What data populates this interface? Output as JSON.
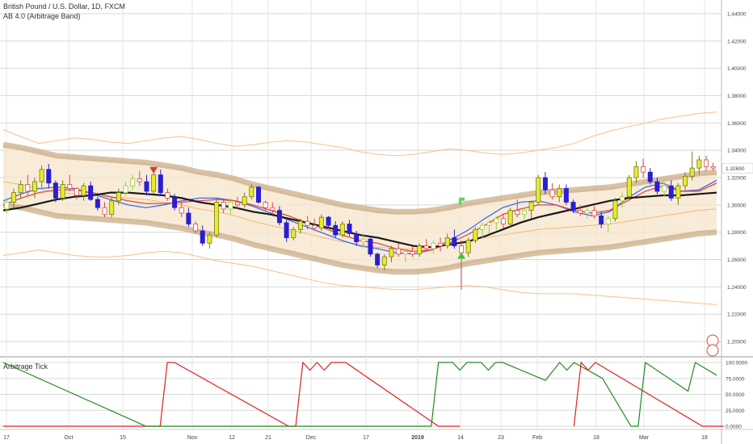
{
  "header": {
    "symbol_title": "British Pound / U.S. Dollar, 1D, FXCM",
    "indicator_name": "AB 4.0 (Arbitrage Band)",
    "sub_pane_title": "Arbitrage Tick"
  },
  "colors": {
    "bull": "#e6ec2a",
    "bear": "#2a1fd0",
    "up_fade": "#9ccc3a",
    "down_fade": "#d64a4a",
    "band": "#c8a880",
    "band_fill": "#f6e6cc",
    "ma_slow": "#1a1a1a",
    "ma_red": "#e8433a",
    "ma_blue": "#3a6cf0",
    "outer_band": "#f5c18a",
    "tick_red": "#e02020",
    "tick_green": "#1f8a1f",
    "current_price_bg": "#e8433a"
  },
  "chart_data": [
    {
      "type": "candlestick",
      "title": "British Pound / U.S. Dollar, 1D, FXCM",
      "subtitle": "AB 4.0 (Arbitrage Band)",
      "y_ticks": [
        "1.44000",
        "1.42000",
        "1.40000",
        "1.38000",
        "1.36000",
        "1.34000",
        "1.32000",
        "1.30000",
        "1.28000",
        "1.26000",
        "1.24000",
        "1.22000",
        "1.20000"
      ],
      "ylim": [
        1.19,
        1.45
      ],
      "x_ticks": [
        "17",
        "Oct",
        "15",
        "Nov",
        "12",
        "21",
        "Dec",
        "17",
        "2019",
        "14",
        "23",
        "Feb",
        "18",
        "Mar",
        "18"
      ],
      "current_price": "1.32690",
      "grid": true,
      "candles": [
        {
          "o": 1.297,
          "h": 1.305,
          "l": 1.294,
          "c": 1.302
        },
        {
          "o": 1.302,
          "h": 1.312,
          "l": 1.298,
          "c": 1.309
        },
        {
          "o": 1.309,
          "h": 1.318,
          "l": 1.305,
          "c": 1.315
        },
        {
          "o": 1.315,
          "h": 1.322,
          "l": 1.307,
          "c": 1.31
        },
        {
          "o": 1.31,
          "h": 1.32,
          "l": 1.305,
          "c": 1.317
        },
        {
          "o": 1.317,
          "h": 1.329,
          "l": 1.313,
          "c": 1.326
        },
        {
          "o": 1.326,
          "h": 1.33,
          "l": 1.312,
          "c": 1.316
        },
        {
          "o": 1.316,
          "h": 1.318,
          "l": 1.302,
          "c": 1.305
        },
        {
          "o": 1.305,
          "h": 1.318,
          "l": 1.303,
          "c": 1.315
        },
        {
          "o": 1.315,
          "h": 1.322,
          "l": 1.31,
          "c": 1.312
        },
        {
          "o": 1.312,
          "h": 1.313,
          "l": 1.304,
          "c": 1.307
        },
        {
          "o": 1.307,
          "h": 1.316,
          "l": 1.303,
          "c": 1.314
        },
        {
          "o": 1.314,
          "h": 1.317,
          "l": 1.303,
          "c": 1.304
        },
        {
          "o": 1.304,
          "h": 1.306,
          "l": 1.296,
          "c": 1.298
        },
        {
          "o": 1.298,
          "h": 1.302,
          "l": 1.291,
          "c": 1.293
        },
        {
          "o": 1.293,
          "h": 1.306,
          "l": 1.291,
          "c": 1.303
        },
        {
          "o": 1.303,
          "h": 1.312,
          "l": 1.3,
          "c": 1.309
        },
        {
          "o": 1.309,
          "h": 1.317,
          "l": 1.306,
          "c": 1.314
        },
        {
          "o": 1.314,
          "h": 1.322,
          "l": 1.311,
          "c": 1.319
        },
        {
          "o": 1.319,
          "h": 1.325,
          "l": 1.314,
          "c": 1.317
        },
        {
          "o": 1.317,
          "h": 1.322,
          "l": 1.307,
          "c": 1.31
        },
        {
          "o": 1.31,
          "h": 1.324,
          "l": 1.308,
          "c": 1.322
        },
        {
          "o": 1.322,
          "h": 1.326,
          "l": 1.307,
          "c": 1.309
        },
        {
          "o": 1.309,
          "h": 1.312,
          "l": 1.303,
          "c": 1.305
        },
        {
          "o": 1.305,
          "h": 1.308,
          "l": 1.296,
          "c": 1.298
        },
        {
          "o": 1.298,
          "h": 1.302,
          "l": 1.291,
          "c": 1.294
        },
        {
          "o": 1.294,
          "h": 1.298,
          "l": 1.284,
          "c": 1.286
        },
        {
          "o": 1.286,
          "h": 1.288,
          "l": 1.279,
          "c": 1.281
        },
        {
          "o": 1.281,
          "h": 1.285,
          "l": 1.27,
          "c": 1.272
        },
        {
          "o": 1.272,
          "h": 1.28,
          "l": 1.268,
          "c": 1.278
        },
        {
          "o": 1.278,
          "h": 1.305,
          "l": 1.276,
          "c": 1.302
        },
        {
          "o": 1.302,
          "h": 1.304,
          "l": 1.294,
          "c": 1.297
        },
        {
          "o": 1.297,
          "h": 1.305,
          "l": 1.293,
          "c": 1.302
        },
        {
          "o": 1.302,
          "h": 1.306,
          "l": 1.297,
          "c": 1.3
        },
        {
          "o": 1.3,
          "h": 1.309,
          "l": 1.298,
          "c": 1.306
        },
        {
          "o": 1.306,
          "h": 1.315,
          "l": 1.304,
          "c": 1.313
        },
        {
          "o": 1.313,
          "h": 1.314,
          "l": 1.301,
          "c": 1.302
        },
        {
          "o": 1.302,
          "h": 1.303,
          "l": 1.296,
          "c": 1.298
        },
        {
          "o": 1.298,
          "h": 1.302,
          "l": 1.293,
          "c": 1.296
        },
        {
          "o": 1.296,
          "h": 1.299,
          "l": 1.285,
          "c": 1.287
        },
        {
          "o": 1.287,
          "h": 1.289,
          "l": 1.273,
          "c": 1.276
        },
        {
          "o": 1.276,
          "h": 1.284,
          "l": 1.274,
          "c": 1.282
        },
        {
          "o": 1.282,
          "h": 1.29,
          "l": 1.279,
          "c": 1.288
        },
        {
          "o": 1.288,
          "h": 1.292,
          "l": 1.282,
          "c": 1.285
        },
        {
          "o": 1.285,
          "h": 1.29,
          "l": 1.281,
          "c": 1.283
        },
        {
          "o": 1.283,
          "h": 1.293,
          "l": 1.281,
          "c": 1.291
        },
        {
          "o": 1.291,
          "h": 1.292,
          "l": 1.283,
          "c": 1.285
        },
        {
          "o": 1.285,
          "h": 1.288,
          "l": 1.276,
          "c": 1.278
        },
        {
          "o": 1.278,
          "h": 1.288,
          "l": 1.276,
          "c": 1.286
        },
        {
          "o": 1.286,
          "h": 1.289,
          "l": 1.277,
          "c": 1.279
        },
        {
          "o": 1.279,
          "h": 1.281,
          "l": 1.27,
          "c": 1.273
        },
        {
          "o": 1.273,
          "h": 1.278,
          "l": 1.269,
          "c": 1.275
        },
        {
          "o": 1.275,
          "h": 1.276,
          "l": 1.262,
          "c": 1.264
        },
        {
          "o": 1.264,
          "h": 1.265,
          "l": 1.254,
          "c": 1.256
        },
        {
          "o": 1.256,
          "h": 1.264,
          "l": 1.252,
          "c": 1.262
        },
        {
          "o": 1.262,
          "h": 1.27,
          "l": 1.258,
          "c": 1.268
        },
        {
          "o": 1.268,
          "h": 1.272,
          "l": 1.262,
          "c": 1.264
        },
        {
          "o": 1.264,
          "h": 1.268,
          "l": 1.258,
          "c": 1.266
        },
        {
          "o": 1.266,
          "h": 1.27,
          "l": 1.262,
          "c": 1.264
        },
        {
          "o": 1.264,
          "h": 1.272,
          "l": 1.262,
          "c": 1.27
        },
        {
          "o": 1.27,
          "h": 1.275,
          "l": 1.266,
          "c": 1.268
        },
        {
          "o": 1.268,
          "h": 1.274,
          "l": 1.264,
          "c": 1.272
        },
        {
          "o": 1.272,
          "h": 1.276,
          "l": 1.266,
          "c": 1.27
        },
        {
          "o": 1.27,
          "h": 1.279,
          "l": 1.268,
          "c": 1.276
        },
        {
          "o": 1.276,
          "h": 1.282,
          "l": 1.268,
          "c": 1.27
        },
        {
          "o": 1.27,
          "h": 1.274,
          "l": 1.238,
          "c": 1.265
        },
        {
          "o": 1.265,
          "h": 1.276,
          "l": 1.262,
          "c": 1.274
        },
        {
          "o": 1.274,
          "h": 1.284,
          "l": 1.272,
          "c": 1.282
        },
        {
          "o": 1.282,
          "h": 1.287,
          "l": 1.276,
          "c": 1.285
        },
        {
          "o": 1.285,
          "h": 1.289,
          "l": 1.279,
          "c": 1.287
        },
        {
          "o": 1.287,
          "h": 1.292,
          "l": 1.282,
          "c": 1.29
        },
        {
          "o": 1.29,
          "h": 1.293,
          "l": 1.283,
          "c": 1.286
        },
        {
          "o": 1.286,
          "h": 1.298,
          "l": 1.284,
          "c": 1.296
        },
        {
          "o": 1.296,
          "h": 1.304,
          "l": 1.291,
          "c": 1.293
        },
        {
          "o": 1.293,
          "h": 1.298,
          "l": 1.289,
          "c": 1.296
        },
        {
          "o": 1.296,
          "h": 1.303,
          "l": 1.29,
          "c": 1.302
        },
        {
          "o": 1.302,
          "h": 1.322,
          "l": 1.3,
          "c": 1.32
        },
        {
          "o": 1.32,
          "h": 1.324,
          "l": 1.308,
          "c": 1.311
        },
        {
          "o": 1.311,
          "h": 1.316,
          "l": 1.304,
          "c": 1.306
        },
        {
          "o": 1.306,
          "h": 1.315,
          "l": 1.302,
          "c": 1.312
        },
        {
          "o": 1.312,
          "h": 1.315,
          "l": 1.3,
          "c": 1.302
        },
        {
          "o": 1.302,
          "h": 1.304,
          "l": 1.294,
          "c": 1.296
        },
        {
          "o": 1.296,
          "h": 1.3,
          "l": 1.292,
          "c": 1.294
        },
        {
          "o": 1.294,
          "h": 1.298,
          "l": 1.29,
          "c": 1.296
        },
        {
          "o": 1.296,
          "h": 1.299,
          "l": 1.29,
          "c": 1.292
        },
        {
          "o": 1.292,
          "h": 1.295,
          "l": 1.283,
          "c": 1.286
        },
        {
          "o": 1.286,
          "h": 1.292,
          "l": 1.28,
          "c": 1.29
        },
        {
          "o": 1.29,
          "h": 1.305,
          "l": 1.288,
          "c": 1.303
        },
        {
          "o": 1.303,
          "h": 1.309,
          "l": 1.298,
          "c": 1.306
        },
        {
          "o": 1.306,
          "h": 1.322,
          "l": 1.304,
          "c": 1.32
        },
        {
          "o": 1.32,
          "h": 1.332,
          "l": 1.316,
          "c": 1.328
        },
        {
          "o": 1.328,
          "h": 1.334,
          "l": 1.32,
          "c": 1.324
        },
        {
          "o": 1.324,
          "h": 1.327,
          "l": 1.315,
          "c": 1.317
        },
        {
          "o": 1.317,
          "h": 1.32,
          "l": 1.308,
          "c": 1.31
        },
        {
          "o": 1.31,
          "h": 1.317,
          "l": 1.306,
          "c": 1.314
        },
        {
          "o": 1.314,
          "h": 1.318,
          "l": 1.303,
          "c": 1.305
        },
        {
          "o": 1.305,
          "h": 1.316,
          "l": 1.3,
          "c": 1.314
        },
        {
          "o": 1.314,
          "h": 1.324,
          "l": 1.31,
          "c": 1.321
        },
        {
          "o": 1.321,
          "h": 1.339,
          "l": 1.318,
          "c": 1.327
        },
        {
          "o": 1.327,
          "h": 1.336,
          "l": 1.322,
          "c": 1.333
        },
        {
          "o": 1.333,
          "h": 1.336,
          "l": 1.325,
          "c": 1.328
        },
        {
          "o": 1.328,
          "h": 1.331,
          "l": 1.325,
          "c": 1.327
        }
      ],
      "ma_slow": [
        1.296,
        1.298,
        1.301,
        1.304,
        1.306,
        1.307,
        1.309,
        1.309,
        1.308,
        1.307,
        1.305,
        1.302,
        1.3,
        1.298,
        1.295,
        1.293,
        1.29,
        1.287,
        1.284,
        1.281,
        1.278,
        1.276,
        1.273,
        1.27,
        1.269,
        1.271,
        1.273,
        1.277,
        1.282,
        1.287,
        1.291,
        1.294,
        1.297,
        1.3,
        1.303,
        1.305,
        1.306,
        1.307,
        1.307,
        1.308,
        1.309
      ],
      "ma_red": [
        1.3,
        1.305,
        1.309,
        1.311,
        1.311,
        1.309,
        1.306,
        1.303,
        1.301,
        1.301,
        1.302,
        1.303,
        1.304,
        1.303,
        1.3,
        1.296,
        1.292,
        1.287,
        1.283,
        1.278,
        1.274,
        1.272,
        1.268,
        1.266,
        1.267,
        1.272,
        1.278,
        1.285,
        1.293,
        1.297,
        1.3,
        1.3,
        1.296,
        1.294,
        1.296,
        1.303,
        1.31,
        1.314,
        1.31,
        1.31,
        1.316
      ],
      "ma_blue": [
        1.303,
        1.308,
        1.312,
        1.313,
        1.312,
        1.308,
        1.304,
        1.3,
        1.298,
        1.3,
        1.303,
        1.305,
        1.305,
        1.303,
        1.299,
        1.294,
        1.289,
        1.284,
        1.279,
        1.274,
        1.27,
        1.268,
        1.265,
        1.264,
        1.267,
        1.274,
        1.281,
        1.29,
        1.298,
        1.302,
        1.303,
        1.3,
        1.295,
        1.292,
        1.295,
        1.305,
        1.313,
        1.316,
        1.31,
        1.311,
        1.318
      ],
      "band_center": [
        1.322,
        1.32,
        1.317,
        1.314,
        1.313,
        1.312,
        1.311,
        1.31,
        1.309,
        1.307,
        1.305,
        1.302,
        1.3,
        1.297,
        1.293,
        1.29,
        1.287,
        1.284,
        1.281,
        1.278,
        1.276,
        1.274,
        1.273,
        1.273,
        1.274,
        1.276,
        1.279,
        1.281,
        1.283,
        1.285,
        1.287,
        1.288,
        1.289,
        1.29,
        1.291,
        1.293,
        1.295,
        1.297,
        1.299,
        1.301,
        1.302
      ],
      "band_halfwidth": 0.022,
      "outer_upper": [
        1.355,
        1.35,
        1.345,
        1.347,
        1.349,
        1.348,
        1.346,
        1.345,
        1.347,
        1.349,
        1.35,
        1.348,
        1.345,
        1.343,
        1.344,
        1.346,
        1.347,
        1.346,
        1.344,
        1.342,
        1.339,
        1.337,
        1.336,
        1.337,
        1.339,
        1.341,
        1.34,
        1.338,
        1.337,
        1.338,
        1.34,
        1.342,
        1.345,
        1.35,
        1.354,
        1.357,
        1.36,
        1.363,
        1.365,
        1.367,
        1.368
      ],
      "outer_lower": [
        1.263,
        1.265,
        1.267,
        1.265,
        1.263,
        1.262,
        1.262,
        1.263,
        1.265,
        1.266,
        1.265,
        1.262,
        1.259,
        1.257,
        1.255,
        1.252,
        1.249,
        1.246,
        1.243,
        1.241,
        1.24,
        1.239,
        1.238,
        1.238,
        1.239,
        1.24,
        1.241,
        1.24,
        1.238,
        1.236,
        1.235,
        1.235,
        1.235,
        1.234,
        1.233,
        1.232,
        1.231,
        1.23,
        1.229,
        1.228,
        1.227
      ],
      "signals": [
        {
          "type": "sell",
          "label": "down-triangle",
          "index": 21,
          "price": 1.326
        },
        {
          "type": "buy",
          "label": "up-triangle",
          "index": 65,
          "price": 1.263
        },
        {
          "type": "buy",
          "label": "flag",
          "index": 65,
          "price": 1.303
        }
      ]
    },
    {
      "type": "line",
      "title": "Arbitrage Tick",
      "y_ticks": [
        "100.0000",
        "75.0000",
        "50.0000",
        "25.0000",
        "0.0000"
      ],
      "ylim": [
        0,
        100
      ],
      "series": [
        {
          "values_red_points": [
            [
              0,
              0
            ],
            [
              22,
              0
            ],
            [
              23,
              100
            ],
            [
              24,
              100
            ],
            [
              40,
              0
            ],
            [
              41,
              0
            ],
            [
              42,
              100
            ],
            [
              43,
              88
            ],
            [
              44,
              100
            ],
            [
              45,
              88
            ],
            [
              46,
              100
            ],
            [
              48,
              100
            ],
            [
              61,
              0
            ],
            [
              64,
              0
            ]
          ]
        },
        {
          "values_red_points_b": [
            [
              80,
              0
            ],
            [
              81,
              100
            ],
            [
              82,
              88
            ],
            [
              83,
              100
            ],
            [
              98,
              0
            ],
            [
              101,
              0
            ]
          ]
        },
        {
          "values_green_points": [
            [
              0,
              100
            ],
            [
              20,
              0
            ],
            [
              60,
              0
            ],
            [
              61,
              100
            ],
            [
              63,
              100
            ],
            [
              64,
              88
            ],
            [
              65,
              100
            ],
            [
              67,
              100
            ],
            [
              68,
              88
            ],
            [
              69,
              100
            ],
            [
              70,
              100
            ],
            [
              76,
              72
            ],
            [
              78,
              100
            ],
            [
              79,
              88
            ],
            [
              80,
              100
            ],
            [
              84,
              75
            ],
            [
              88,
              0
            ],
            [
              89,
              0
            ],
            [
              90,
              100
            ],
            [
              96,
              55
            ],
            [
              97,
              100
            ],
            [
              100,
              80
            ]
          ]
        }
      ]
    }
  ]
}
